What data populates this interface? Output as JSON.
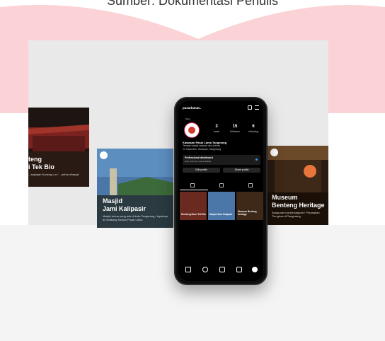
{
  "caption": "Sumber: Dokumentasi Penulis",
  "cards": [
    {
      "title_line1": "teng",
      "title_line2": "i Tek Bio",
      "desc": "...anjunjan Koneng Lor / ...adhar dharyal"
    },
    {
      "title_line1": "Masjid",
      "title_line2": "Jami Kalipasir",
      "desc": "Masjid tertua yang ada di kota Tangerang / tepatnya di belakang Kasaul Pasar Lama"
    },
    {
      "title_line1": "Museum",
      "title_line2": "Benteng Heritage",
      "desc": "Bangunan tua bersejarah / Peranakan Tionghoa di Tangerang"
    }
  ],
  "phone": {
    "username": "pasarlamat..",
    "story_label": "Story",
    "stats": [
      {
        "value": "3",
        "label": "posts"
      },
      {
        "value": "15",
        "label": "followers"
      },
      {
        "value": "6",
        "label": "following"
      }
    ],
    "bio_name": "Kawasan Pasar Lama Tangerang",
    "bio_line1": "Tempat wisata sejarah dan kuliner",
    "bio_line2": "Jl. Kisamaun, Sukasari, Tangerang",
    "dashboard_title": "Professional dashboard",
    "dashboard_sub": "New tools are now available",
    "edit_label": "Edit profile",
    "share_label": "Share profile",
    "posts": [
      {
        "title": "Klenteng Boen Tek Bio",
        "desc": "..."
      },
      {
        "title": "Masjid Jami Kalipasir",
        "desc": "..."
      },
      {
        "title": "Museum Benteng Heritage",
        "desc": "..."
      }
    ]
  }
}
